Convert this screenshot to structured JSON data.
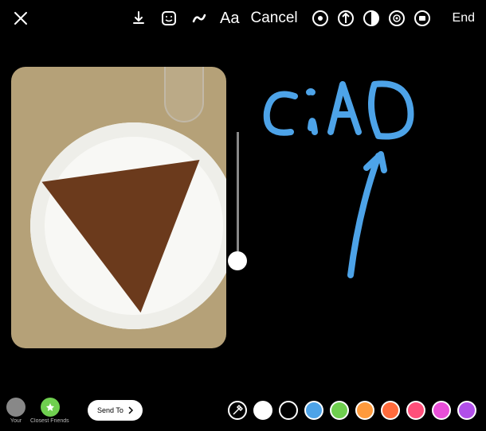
{
  "toolbar": {
    "text_tool_label": "Aa",
    "cancel_label": "Cancel",
    "end_label": "End"
  },
  "story_options": {
    "your_story_label": "Your",
    "close_friends_label": "Closest Friends Story"
  },
  "send_to": {
    "label": "Send To"
  },
  "handwriting": {
    "text": "CiAO",
    "color": "#4da3e8"
  },
  "palette": {
    "colors": [
      "#ffffff",
      "#000000",
      "#4da3e8",
      "#6fcf4f",
      "#ff9a3c",
      "#ff6b3c",
      "#ff4f7a",
      "#e94fd8",
      "#b14fe9"
    ]
  },
  "icons": {
    "close": "close-icon",
    "download": "download-icon",
    "sticker": "sticker-icon",
    "draw": "draw-icon",
    "pen1": "pen-outline-icon",
    "pen2": "pen-fill-up-icon",
    "pen3": "pen-half-icon",
    "pen4": "pen-glow-icon",
    "pen5": "pen-eraser-icon",
    "eyedropper": "eyedropper-icon",
    "chevron": "chevron-right-icon"
  }
}
